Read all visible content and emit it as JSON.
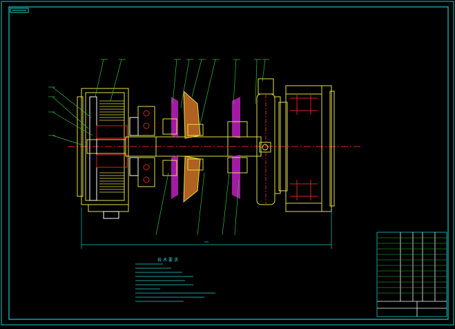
{
  "drawing": {
    "background": "#000000",
    "frame_color": "#18c8c8",
    "part_color": "#e6e040",
    "section_color": "#c020c0",
    "centerline_color": "#e02020",
    "leader_color": "#30c040",
    "note_color": "#30d0d0",
    "title_block_color": "#ffffff"
  },
  "notes": {
    "heading": "技术要求"
  }
}
